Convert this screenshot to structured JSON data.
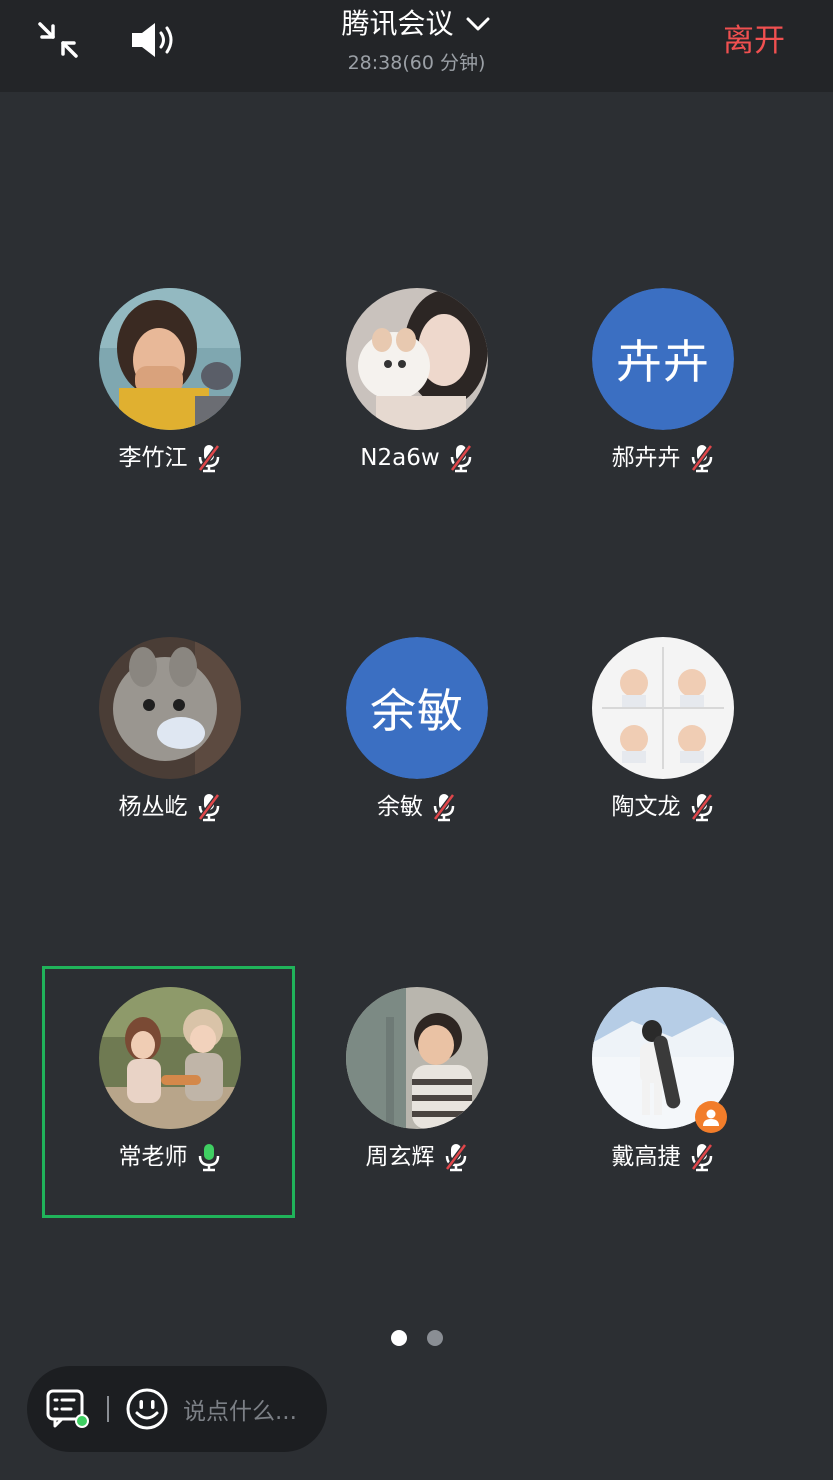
{
  "header": {
    "title": "腾讯会议",
    "timer": "28:38(60 分钟)",
    "leave_label": "离开",
    "icons": [
      "collapse-icon",
      "speaker-icon",
      "chevron-down-icon"
    ]
  },
  "participants": [
    {
      "name": "李竹江",
      "avatar": "photo",
      "mic": "muted"
    },
    {
      "name": "N2a6w",
      "avatar": "photo",
      "mic": "muted"
    },
    {
      "name": "郝卉卉",
      "avatar": "initials",
      "initials": "卉卉",
      "mic": "muted"
    },
    {
      "name": "杨丛屹",
      "avatar": "photo",
      "mic": "muted"
    },
    {
      "name": "余敏",
      "avatar": "initials",
      "initials": "余敏",
      "mic": "muted"
    },
    {
      "name": "陶文龙",
      "avatar": "photo",
      "mic": "muted"
    },
    {
      "name": "常老师",
      "avatar": "photo",
      "mic": "active",
      "speaking": true
    },
    {
      "name": "周玄辉",
      "avatar": "photo",
      "mic": "muted"
    },
    {
      "name": "戴高捷",
      "avatar": "photo",
      "mic": "muted",
      "host_badge": true
    }
  ],
  "pager": {
    "pages": 2,
    "current": 1
  },
  "chat": {
    "placeholder": "说点什么..."
  },
  "colors": {
    "background": "#2c2f33",
    "topbar": "#232528",
    "leave": "#f05050",
    "speaking_border": "#20b35a",
    "initials_avatar": "#3b6fc2",
    "mic_muted_slash": "#e0464a",
    "mic_active": "#3fcf62"
  }
}
